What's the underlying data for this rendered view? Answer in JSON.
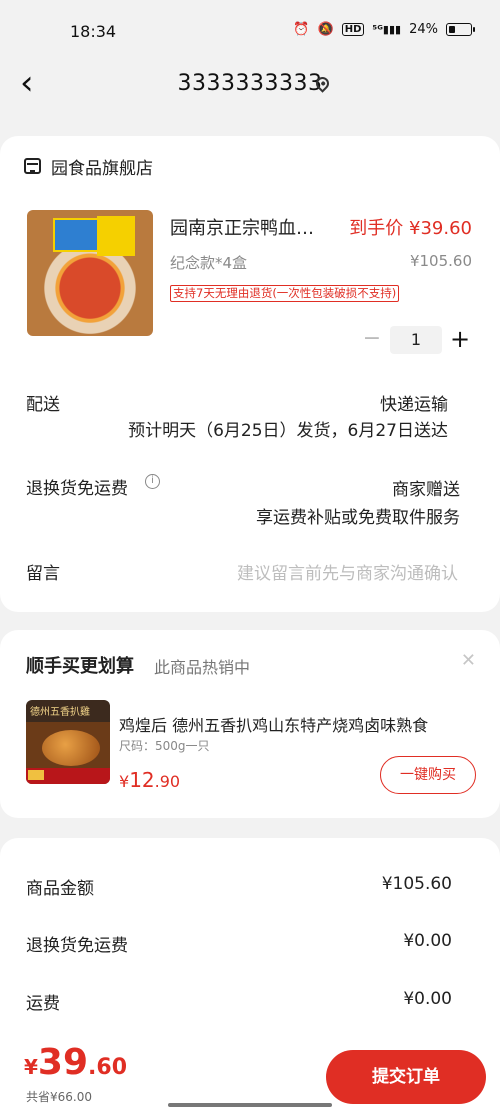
{
  "status": {
    "time": "18:34",
    "battery": "24%",
    "icons": [
      "alarm-icon",
      "mute-icon",
      "hd-icon",
      "signal-5g-icon"
    ]
  },
  "header": {
    "title": "3333333333"
  },
  "store": {
    "name": "园食品旗舰店"
  },
  "product": {
    "title": "园南京正宗鸭血粉丝",
    "price": "到手价 ¥39.60",
    "variant": "纪念款*4盒",
    "original_price": "¥105.60",
    "return_tag": "支持7天无理由退货(一次性包装破损不支持)",
    "quantity": "1"
  },
  "rows": {
    "delivery_label": "配送",
    "delivery_method": "快递运输",
    "delivery_eta": "预计明天（6月25日）发货，6月27日送达",
    "return_shipping_label": "退换货免运费",
    "return_shipping_value": "商家赠送",
    "return_shipping_desc": "享运费补贴或免费取件服务",
    "message_label": "留言",
    "message_placeholder": "建议留言前先与商家沟通确认"
  },
  "upsell": {
    "title": "顺手买更划算",
    "subtitle": "此商品热销中",
    "image_caption": "德州五香扒雞",
    "name": "鸡煌后 德州五香扒鸡山东特产烧鸡卤味熟食",
    "spec": "尺码：500g一只",
    "price_currency": "¥",
    "price_int": "12",
    "price_dec": ".90",
    "buy_label": "一键购买"
  },
  "summary": {
    "goods_label": "商品金额",
    "goods_value": "¥105.60",
    "return_label": "退换货免运费",
    "return_value": "¥0.00",
    "freight_label": "运费",
    "freight_value": "¥0.00"
  },
  "bottom": {
    "currency": "¥",
    "total_int": "39",
    "total_dec": ".60",
    "original_total": "共省¥66.00",
    "submit_label": "提交订单"
  },
  "colors": {
    "accent": "#e02e24",
    "background": "#f2f2f2"
  }
}
